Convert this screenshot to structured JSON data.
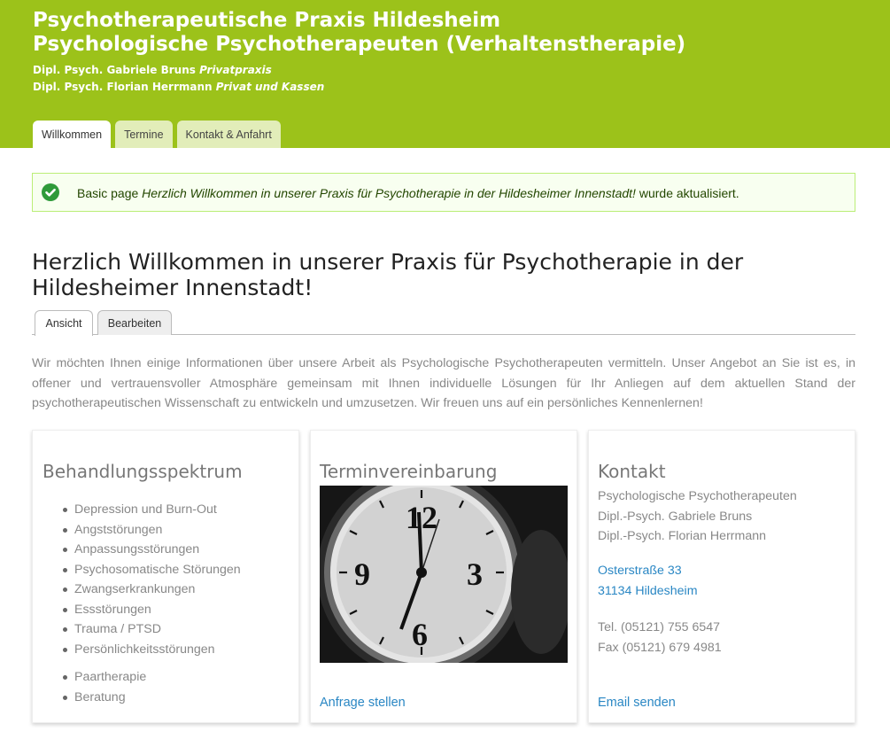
{
  "header": {
    "title_line1": "Psychotherapeutische Praxis Hildesheim",
    "title_line2": "Psychologische Psychotherapeuten (Verhaltenstherapie)",
    "slogan": [
      {
        "name": "Dipl. Psych. Gabriele Bruns",
        "note": "Privatpraxis"
      },
      {
        "name": "Dipl. Psych. Florian Herrmann",
        "note": "Privat und Kassen"
      }
    ],
    "colors": {
      "brand": "#9cc21a",
      "link": "#2a87c4"
    }
  },
  "main_tabs": [
    {
      "label": "Willkommen",
      "active": true
    },
    {
      "label": "Termine",
      "active": false
    },
    {
      "label": "Kontakt & Anfahrt",
      "active": false
    }
  ],
  "message": {
    "icon": "check-circle-icon",
    "prefix": "Basic page",
    "page_name": "Herzlich Willkommen in unserer Praxis für Psychotherapie in der Hildesheimer Innenstadt!",
    "suffix": "wurde aktualisiert."
  },
  "page_title": "Herzlich Willkommen in unserer Praxis für Psychotherapie in der Hildesheimer Innenstadt!",
  "local_tabs": [
    {
      "label": "Ansicht",
      "active": true
    },
    {
      "label": "Bearbeiten",
      "active": false
    }
  ],
  "intro": "Wir möchten Ihnen einige Informationen über unsere Arbeit als Psychologische Psychotherapeuten vermitteln. Unser Angebot an Sie ist es, in offener und vertrauensvoller Atmosphäre gemeinsam mit Ihnen individuelle Lösungen für Ihr Anliegen auf dem aktuellen Stand der psychotherapeutischen Wissenschaft zu entwickeln und umzusetzen. Wir freuen uns auf ein persönliches Kennenlernen!",
  "cards": {
    "spectrum": {
      "title": "Behandlungsspektrum",
      "items": [
        "Depression und Burn-Out",
        "Angststörungen",
        "Anpassungsstörungen",
        "Psychosomatische Störungen",
        "Zwangserkrankungen",
        "Essstörungen",
        "Trauma / PTSD",
        "Persönlichkeitsstörungen"
      ],
      "items2": [
        "Paartherapie",
        "Beratung"
      ]
    },
    "appointment": {
      "title": "Terminvereinbarung",
      "image_alt": "clock-image",
      "link": "Anfrage stellen"
    },
    "contact": {
      "title": "Kontakt",
      "lines": [
        "Psychologische Psychotherapeuten",
        "Dipl.-Psych. Gabriele Bruns",
        "Dipl.-Psych. Florian Herrmann"
      ],
      "street": "Osterstraße 33",
      "city": "31134 Hildesheim",
      "tel": "Tel. (05121) 755 6547",
      "fax": "Fax (05121) 679 4981",
      "link": "Email senden"
    }
  }
}
